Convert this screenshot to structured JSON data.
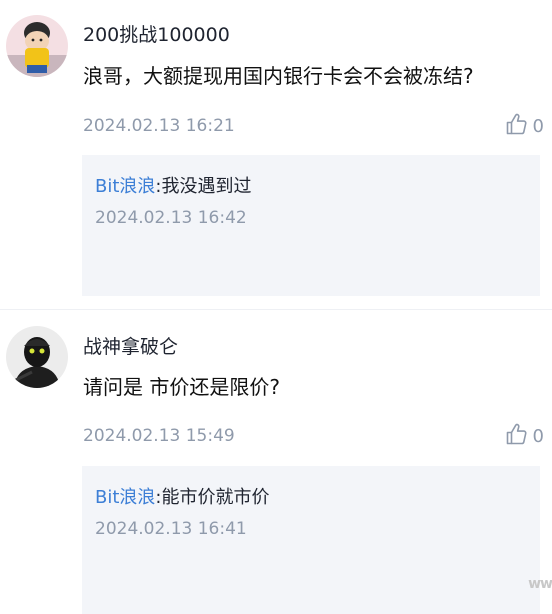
{
  "comments": [
    {
      "username": "200挑战100000",
      "content": "浪哥，大额提现用国内银行卡会不会被冻结?",
      "time": "2024.02.13 16:21",
      "likes": "0",
      "reply": {
        "author": "Bit浪浪",
        "text": ":我没遇到过",
        "time": "2024.02.13 16:42"
      }
    },
    {
      "username": "战神拿破仑",
      "content": "请问是 市价还是限价?",
      "time": "2024.02.13 15:49",
      "likes": "0",
      "reply": {
        "author": "Bit浪浪",
        "text": ":能市价就市价",
        "time": "2024.02.13 16:41"
      }
    }
  ],
  "watermark": "ww",
  "icons": {
    "like": "thumbs-up-icon"
  },
  "colors": {
    "link": "#3d7fd6",
    "muted": "#8f9aab",
    "reply_bg": "#f3f5f9"
  }
}
